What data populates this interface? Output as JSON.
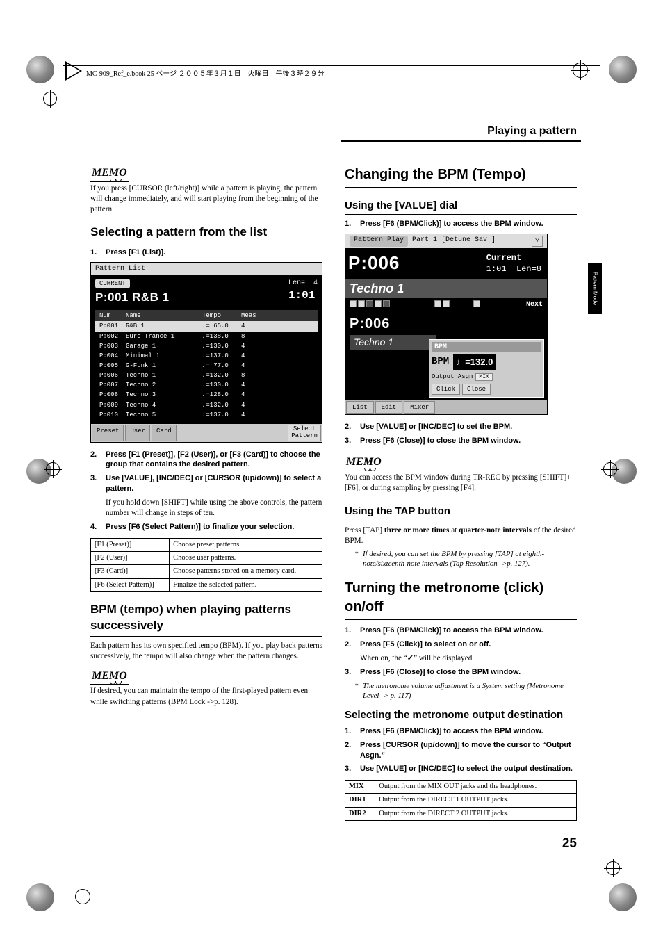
{
  "topbar": "MC-909_Ref_e.book 25 ページ ２００５年３月１日　火曜日　午後３時２９分",
  "section_header": "Playing a pattern",
  "side_tab": "Pattern Mode",
  "page_number": "25",
  "left": {
    "memo_text": "If you press [CURSOR (left/right)] while a pattern is playing, the pattern will change immediately, and will start playing from the beginning of the pattern.",
    "h_select_list": "Selecting a pattern from the list",
    "step1": "Press [F1 (List)].",
    "shot1": {
      "title": "Pattern List",
      "current": "CURRENT",
      "pat": "P:001 R&B 1",
      "len_label": "Len=",
      "len_val": "4",
      "pos": "1:01",
      "hdr_num": "Num",
      "hdr_name": "Name",
      "hdr_tempo": "Tempo",
      "hdr_meas": "Meas",
      "rows": [
        {
          "num": "P:001",
          "name": "R&B 1",
          "tempo": "♩= 65.0",
          "meas": "4"
        },
        {
          "num": "P:002",
          "name": "Euro Trance 1",
          "tempo": "♩=138.0",
          "meas": "8"
        },
        {
          "num": "P:003",
          "name": "Garage 1",
          "tempo": "♩=130.0",
          "meas": "4"
        },
        {
          "num": "P:004",
          "name": "Minimal 1",
          "tempo": "♩=137.0",
          "meas": "4"
        },
        {
          "num": "P:005",
          "name": "G-Funk 1",
          "tempo": "♩= 77.0",
          "meas": "4"
        },
        {
          "num": "P:006",
          "name": "Techno 1",
          "tempo": "♩=132.0",
          "meas": "8"
        },
        {
          "num": "P:007",
          "name": "Techno 2",
          "tempo": "♩=130.0",
          "meas": "4"
        },
        {
          "num": "P:008",
          "name": "Techno 3",
          "tempo": "♩=128.0",
          "meas": "4"
        },
        {
          "num": "P:009",
          "name": "Techno 4",
          "tempo": "♩=132.0",
          "meas": "4"
        },
        {
          "num": "P:010",
          "name": "Techno 5",
          "tempo": "♩=137.0",
          "meas": "4"
        }
      ],
      "btn_preset": "Preset",
      "btn_user": "User",
      "btn_card": "Card",
      "btn_select": "Select\nPattern"
    },
    "step2": "Press [F1 (Preset)], [F2 (User)], or [F3 (Card)] to choose the group that contains the desired pattern.",
    "step3": "Use [VALUE], [INC/DEC] or [CURSOR (up/down)] to select a pattern.",
    "step3_note": "If you hold down [SHIFT] while using the above controls, the pattern number will change in steps of ten.",
    "step4": "Press [F6 (Select Pattern)] to finalize your selection.",
    "table1": [
      {
        "k": "[F1 (Preset)]",
        "v": "Choose preset patterns."
      },
      {
        "k": "[F2 (User)]",
        "v": "Choose user patterns."
      },
      {
        "k": "[F3 (Card)]",
        "v": "Choose patterns stored on a memory card."
      },
      {
        "k": "[F6 (Select Pattern)]",
        "v": "Finalize the selected pattern."
      }
    ],
    "h_bpm_succ": "BPM (tempo) when playing patterns successively",
    "bpm_succ_p": "Each pattern has its own specified tempo (BPM). If you play back patterns successively, the tempo will also change when the pattern changes.",
    "memo2": "If desired, you can maintain the tempo of the first-played pattern even while switching patterns (BPM Lock ->p. 128)."
  },
  "right": {
    "h_change_bpm": "Changing the BPM (Tempo)",
    "h_value_dial": "Using the [VALUE] dial",
    "r_step1": "Press [F6 (BPM/Click)] to access the BPM window.",
    "shot2": {
      "title": "Pattern Play",
      "part": "Part 1",
      "detune": "[Detune Sav  ]",
      "current": "Current",
      "pnum_top": "P:006",
      "pos": "1:01",
      "len": "Len=8",
      "pname": "Techno 1",
      "next": "Next",
      "pnum_low": "P:006",
      "pname_low": "Techno 1",
      "bpm_title": "BPM",
      "bpm_label": "BPM",
      "bpm_val": "♩=132.0",
      "out_asgn": "Output Asgn",
      "mix": "MIX",
      "btn_click": "Click",
      "btn_close": "Close",
      "f_list": "List",
      "f_edit": "Edit",
      "f_mixer": "Mixer"
    },
    "r_step2": "Use [VALUE] or [INC/DEC] to set the BPM.",
    "r_step3": "Press [F6 (Close)] to close the BPM window.",
    "r_memo": "You can access the BPM window during TR-REC by pressing [SHIFT]+[F6], or during sampling by pressing [F4].",
    "h_tap": "Using the TAP button",
    "tap_p1a": "Press [TAP] ",
    "tap_p1b": "three or more times",
    "tap_p1c": " at ",
    "tap_p1d": "quarter-note intervals",
    "tap_p1e": " of the desired BPM.",
    "tap_note": "If desired, you can set the BPM by pressing [TAP] at eighth-note/sixteenth-note intervals (Tap Resolution ->p. 127).",
    "h_metro": "Turning the metronome (click) on/off",
    "m_step1": "Press [F6 (BPM/Click)] to access the BPM window.",
    "m_step2": "Press [F5 (Click)] to select on or off.",
    "m_step2_sub": "When on, the “✔” will be displayed.",
    "m_step3": "Press [F6 (Close)] to close the BPM window.",
    "m_note": "The metronome volume adjustment is a System setting (Metronome Level -> p. 117)",
    "h_metro_out": "Selecting the metronome output destination",
    "o_step1": "Press [F6 (BPM/Click)] to access the BPM window.",
    "o_step2": "Press [CURSOR (up/down)] to move the cursor to “Output Asgn.”",
    "o_step3": "Use [VALUE] or [INC/DEC] to select the output destination.",
    "table2": [
      {
        "k": "MIX",
        "v": "Output from the MIX OUT jacks and the headphones."
      },
      {
        "k": "DIR1",
        "v": "Output from the DIRECT 1 OUTPUT jacks."
      },
      {
        "k": "DIR2",
        "v": "Output from the DIRECT 2 OUTPUT jacks."
      }
    ]
  }
}
